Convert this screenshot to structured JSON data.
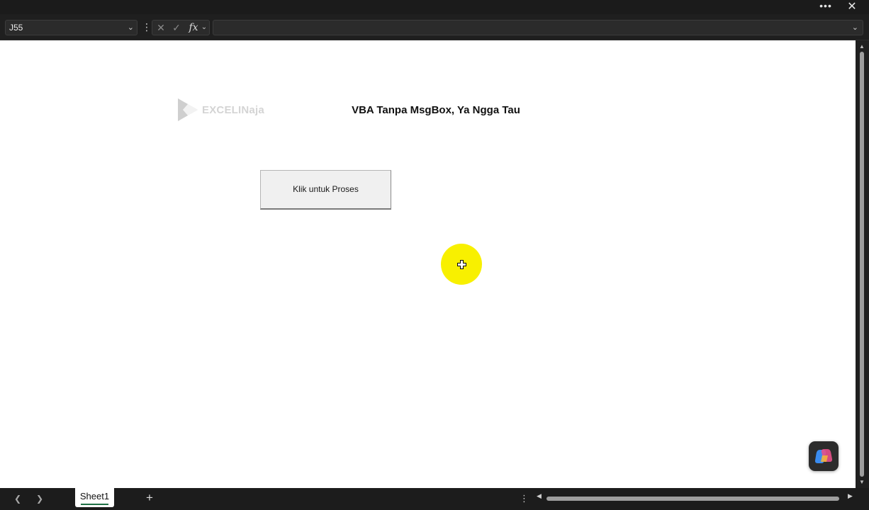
{
  "window": {
    "more_icon": "more-horizontal-icon",
    "close_icon": "close-icon",
    "more_glyph": "•••",
    "close_glyph": "✕"
  },
  "formula_bar": {
    "name_box_value": "J55",
    "formula_value": "",
    "fx_label": "fx"
  },
  "sheet": {
    "logo_text": "EXCELINaja",
    "title": "VBA Tanpa MsgBox, Ya Ngga Tau",
    "button_label": "Klik untuk Proses"
  },
  "tabs": {
    "items": [
      {
        "label": "Sheet1",
        "active": true
      }
    ],
    "add_glyph": "+"
  },
  "colors": {
    "cursor_highlight": "#f8f000",
    "active_tab_underline": "#1e7145",
    "chrome_bg": "#1c1c1c"
  }
}
